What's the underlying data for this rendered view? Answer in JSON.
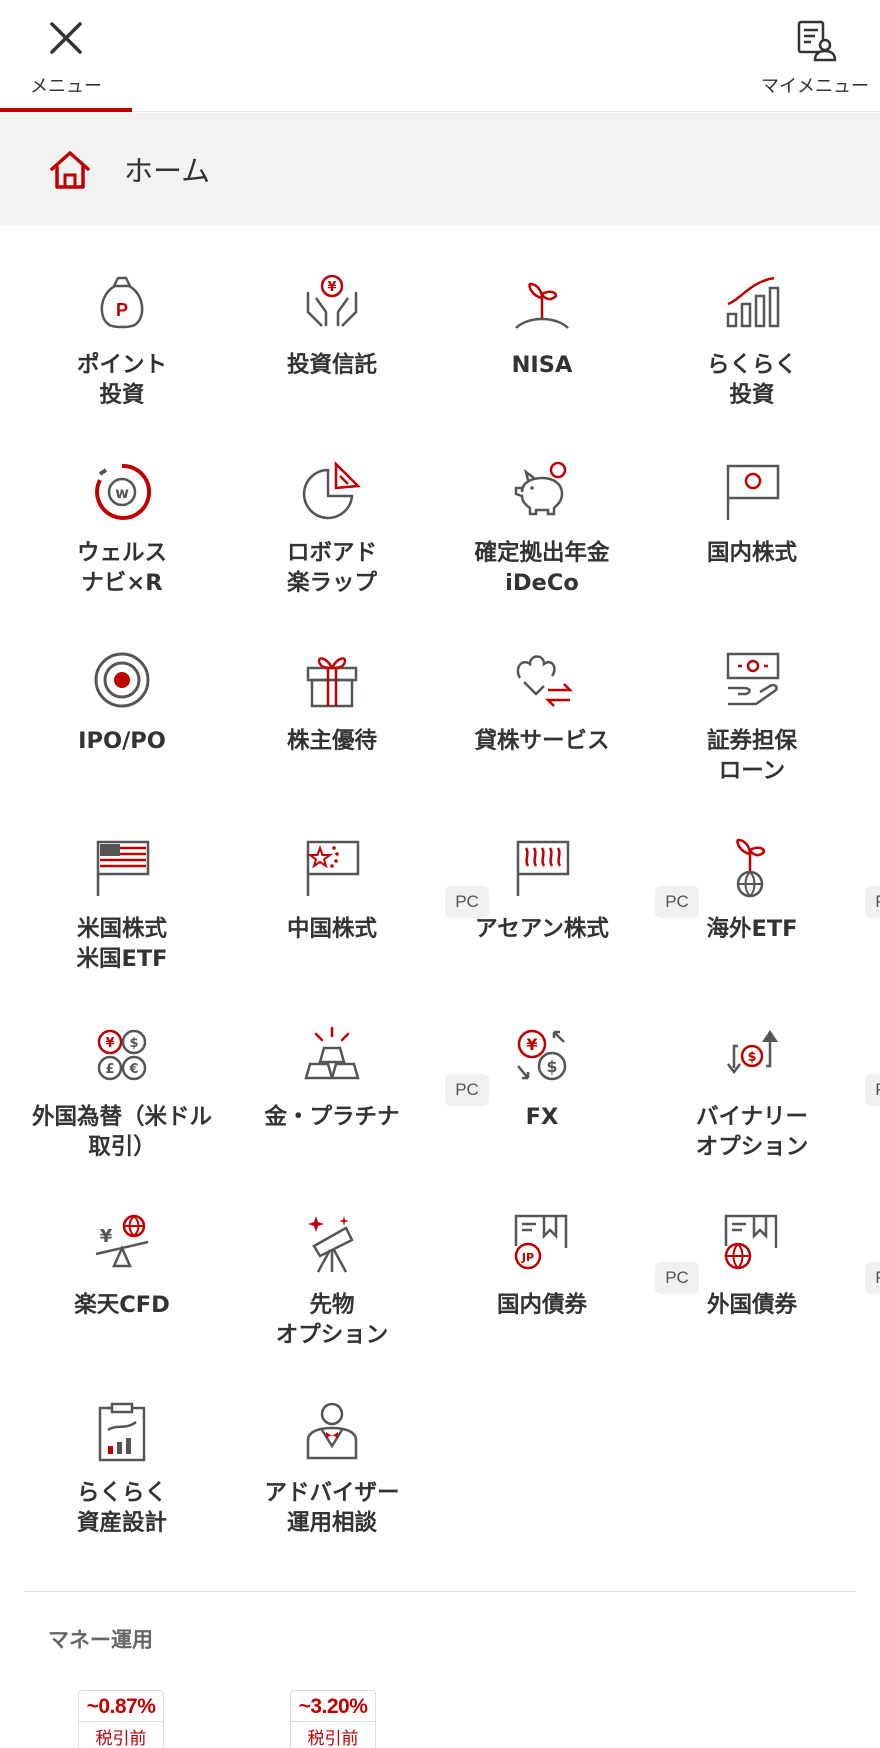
{
  "header": {
    "menu_label": "メニュー",
    "my_menu_label": "マイメニュー"
  },
  "home": {
    "label": "ホーム"
  },
  "colors": {
    "accent": "#bf0000",
    "icon_gray": "#555555"
  },
  "menu_items": [
    {
      "label": "ポイント\n投資",
      "icon": "point-bag-icon",
      "pc": false
    },
    {
      "label": "投資信託",
      "icon": "yen-hands-icon",
      "pc": false
    },
    {
      "label": "NISA",
      "icon": "sprout-icon",
      "pc": false
    },
    {
      "label": "らくらく\n投資",
      "icon": "bar-growth-icon",
      "pc": false
    },
    {
      "label": "ウェルス\nナビ×R",
      "icon": "wealthnavi-icon",
      "pc": false
    },
    {
      "label": "ロボアド\n楽ラップ",
      "icon": "pie-chart-icon",
      "pc": false
    },
    {
      "label": "確定拠出年金\niDeCo",
      "icon": "piggy-bank-icon",
      "pc": false
    },
    {
      "label": "国内株式",
      "icon": "japan-flag-icon",
      "pc": false
    },
    {
      "label": "IPO/PO",
      "icon": "target-icon",
      "pc": false
    },
    {
      "label": "株主優待",
      "icon": "gift-icon",
      "pc": false
    },
    {
      "label": "貸株サービス",
      "icon": "lending-icon",
      "pc": false
    },
    {
      "label": "証券担保\nローン",
      "icon": "cash-hand-icon",
      "pc": false
    },
    {
      "label": "米国株式\n米国ETF",
      "icon": "us-flag-icon",
      "pc": false
    },
    {
      "label": "中国株式",
      "icon": "china-flag-icon",
      "pc": true
    },
    {
      "label": "アセアン株式",
      "icon": "asean-flag-icon",
      "pc": true
    },
    {
      "label": "海外ETF",
      "icon": "globe-sprout-icon",
      "pc": true
    },
    {
      "label": "外国為替（米ドル\n取引）",
      "icon": "currency-coins-icon",
      "pc": false
    },
    {
      "label": "金・プラチナ",
      "icon": "gold-bars-icon",
      "pc": true
    },
    {
      "label": "FX",
      "icon": "fx-exchange-icon",
      "pc": false
    },
    {
      "label": "バイナリー\nオプション",
      "icon": "binary-option-icon",
      "pc": true
    },
    {
      "label": "楽天CFD",
      "icon": "cfd-seesaw-icon",
      "pc": false
    },
    {
      "label": "先物\nオプション",
      "icon": "telescope-icon",
      "pc": false
    },
    {
      "label": "国内債券",
      "icon": "jp-bond-icon",
      "pc": true
    },
    {
      "label": "外国債券",
      "icon": "foreign-bond-icon",
      "pc": true
    },
    {
      "label": "らくらく\n資産設計",
      "icon": "clipboard-chart-icon",
      "pc": false
    },
    {
      "label": "アドバイザー\n運用相談",
      "icon": "advisor-icon",
      "pc": false
    }
  ],
  "pc_badge_label": "PC",
  "money_section": {
    "title": "マネー運用",
    "cards": [
      {
        "rate": "~0.87%",
        "tax": "税引前"
      },
      {
        "rate": "~3.20%",
        "tax": "税引前"
      }
    ]
  }
}
